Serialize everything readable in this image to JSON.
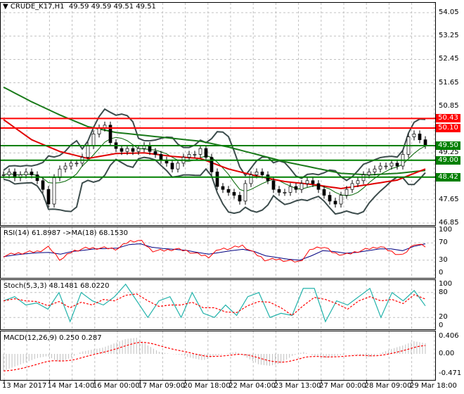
{
  "header": {
    "symbol": "CRUDE_K17,H1",
    "ohlc": "49.59 49.59 49.51 49.51"
  },
  "colors": {
    "up_level": "#ff0000",
    "down_level": "#008000",
    "bands": "#3c4c4c",
    "long_ma": "#1a7a1a",
    "mid_ma": "#e00000",
    "rsi": "#ff0000",
    "rsi_ma": "#000080",
    "stoch_main": "#20b2aa",
    "stoch_signal": "#ff0000",
    "macd_hist": "#c0c0c0",
    "macd_signal": "#ff0000"
  },
  "chart_data": [
    {
      "type": "line",
      "title": "CRUDE_K17,H1",
      "pane": "price",
      "ylim": [
        46.85,
        54.05
      ],
      "y_ticks": [
        "54.05",
        "53.25",
        "52.45",
        "51.65",
        "50.85",
        "49.25",
        "47.65",
        "46.85"
      ],
      "x_ticks": [
        "13 Mar 2017",
        "14 Mar 14:00",
        "16 Mar 00:00",
        "17 Mar 09:00",
        "20 Mar 18:00",
        "22 Mar 04:00",
        "23 Mar 13:00",
        "27 Mar 00:00",
        "28 Mar 09:00",
        "29 Mar 18:00"
      ],
      "grid": true,
      "levels": [
        {
          "value": "50.43",
          "color": "#ff0000"
        },
        {
          "value": "50.10",
          "color": "#ff0000"
        },
        {
          "value": "49.50",
          "color": "#008000"
        },
        {
          "value": "49.00",
          "color": "#008000"
        },
        {
          "value": "48.42",
          "color": "#008000"
        }
      ],
      "close": [
        48.5,
        48.6,
        48.4,
        48.5,
        48.6,
        48.5,
        48.3,
        48.0,
        47.5,
        48.4,
        48.7,
        48.8,
        48.9,
        48.9,
        49.1,
        49.5,
        49.9,
        50.1,
        50.2,
        49.6,
        49.4,
        49.3,
        49.4,
        49.3,
        49.4,
        49.5,
        49.3,
        49.2,
        49.0,
        48.9,
        48.7,
        48.9,
        49.1,
        49.2,
        49.2,
        49.4,
        49.1,
        48.6,
        48.1,
        48.0,
        47.9,
        47.8,
        47.6,
        48.2,
        48.5,
        48.6,
        48.5,
        48.3,
        48.0,
        47.9,
        47.9,
        48.1,
        48.0,
        48.2,
        48.3,
        48.2,
        48.0,
        47.8,
        47.6,
        47.5,
        47.8,
        48.0,
        48.2,
        48.3,
        48.5,
        48.6,
        48.7,
        48.8,
        48.8,
        48.9,
        48.8,
        49.2,
        49.8,
        49.9,
        49.7,
        49.51
      ],
      "long_ma": [
        51.5,
        51.0,
        50.55,
        50.15,
        49.95,
        49.85,
        49.75,
        49.65,
        49.45,
        49.2,
        48.95,
        48.75,
        48.55,
        48.5,
        48.55,
        48.65
      ],
      "mid_ma": [
        50.39,
        49.7,
        49.3,
        49.06,
        49.23,
        49.25,
        49.13,
        49.06,
        48.7,
        48.46,
        48.27,
        48.17,
        48.03,
        48.17,
        48.32,
        48.7
      ]
    },
    {
      "type": "line",
      "pane": "rsi",
      "title": "RSI(14) 61.8987  ->MA(18) 68.1530",
      "ylim": [
        0,
        100
      ],
      "y_ticks": [
        "100",
        "70",
        "30",
        "0"
      ],
      "rsi": [
        40,
        45,
        48,
        50,
        60,
        30,
        50,
        57,
        58,
        58,
        56,
        74,
        76,
        52,
        52,
        56,
        52,
        44,
        38,
        56,
        58,
        64,
        46,
        30,
        32,
        28,
        26,
        56,
        62,
        46,
        42,
        50,
        56,
        62,
        50,
        40,
        68,
        62
      ],
      "rsi_ma": [
        38,
        42,
        45,
        47,
        48,
        44,
        50,
        53,
        56,
        57,
        58,
        66,
        68,
        60,
        57,
        55,
        53,
        48,
        44,
        48,
        52,
        55,
        50,
        40,
        36,
        32,
        30,
        40,
        52,
        50,
        46,
        48,
        52,
        56,
        56,
        52,
        62,
        68
      ]
    },
    {
      "type": "line",
      "pane": "stochastic",
      "title": "Stoch(5,3,3) 48.1481 68.0220",
      "ylim": [
        0,
        100
      ],
      "y_ticks": [
        "100",
        "80",
        "20",
        "0"
      ],
      "main": [
        60,
        70,
        50,
        55,
        40,
        80,
        10,
        80,
        60,
        50,
        70,
        100,
        60,
        20,
        60,
        70,
        20,
        80,
        30,
        20,
        50,
        25,
        70,
        80,
        20,
        30,
        25,
        90,
        90,
        10,
        60,
        50,
        70,
        90,
        20,
        80,
        60,
        85,
        48
      ]
    },
    {
      "type": "bar",
      "pane": "macd",
      "title": "MACD(12,26,9) 0.250 0.287",
      "ylim": [
        -0.471,
        0.406
      ],
      "y_ticks": [
        "0.406",
        "0.00",
        "-0.471"
      ],
      "histogram": [
        -0.4,
        -0.3,
        -0.2,
        -0.1,
        -0.05,
        -0.2,
        -0.1,
        0.05,
        0.1,
        0.15,
        0.25,
        0.35,
        0.38,
        0.2,
        0.05,
        0.0,
        -0.02,
        -0.1,
        -0.15,
        -0.05,
        0.0,
        0.05,
        -0.1,
        -0.25,
        -0.28,
        -0.22,
        -0.05,
        0.05,
        -0.05,
        -0.1,
        -0.05,
        0.0,
        -0.02,
        -0.08,
        0.02,
        0.12,
        0.2,
        0.3,
        0.25
      ]
    }
  ]
}
